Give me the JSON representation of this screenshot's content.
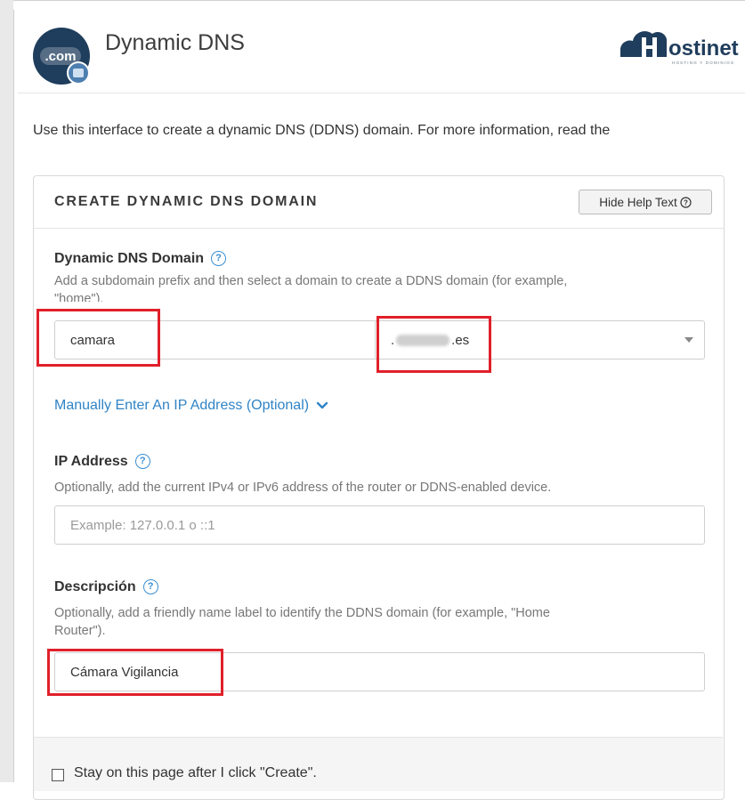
{
  "header": {
    "title": "Dynamic DNS",
    "app_icon_text": ".com",
    "brand": "Hostinet",
    "brand_tagline": "HOSTING Y DOMINIOS"
  },
  "intro_text": "Use this interface to create a dynamic DNS (DDNS) domain. For more information, read the",
  "panel": {
    "title": "CREATE DYNAMIC DNS DOMAIN",
    "help_button": "Hide Help Text",
    "domain": {
      "label": "Dynamic DNS Domain",
      "hint_line1": "Add a subdomain prefix and then select a domain to create a DDNS domain (for example,",
      "hint_line2": "\"home\").",
      "subdomain_value": "camara",
      "domain_prefix": ".",
      "domain_suffix": ".es"
    },
    "manual_ip_link": "Manually Enter An IP Address (Optional)",
    "ip": {
      "label": "IP Address",
      "hint": "Optionally, add the current IPv4 or IPv6 address of the router or DDNS-enabled device.",
      "placeholder": "Example: 127.0.0.1 o ::1"
    },
    "description": {
      "label": "Descripción",
      "hint_line1": "Optionally, add a friendly name label to identify the DDNS domain (for example, \"Home",
      "hint_line2": "Router\").",
      "value": "Cámara Vigilancia"
    },
    "footer_checkbox_label": "Stay on this page after I click \"Create\"."
  },
  "colors": {
    "highlight": "#e0202a",
    "link": "#2f84c6",
    "help_icon": "#3a8fd3"
  }
}
